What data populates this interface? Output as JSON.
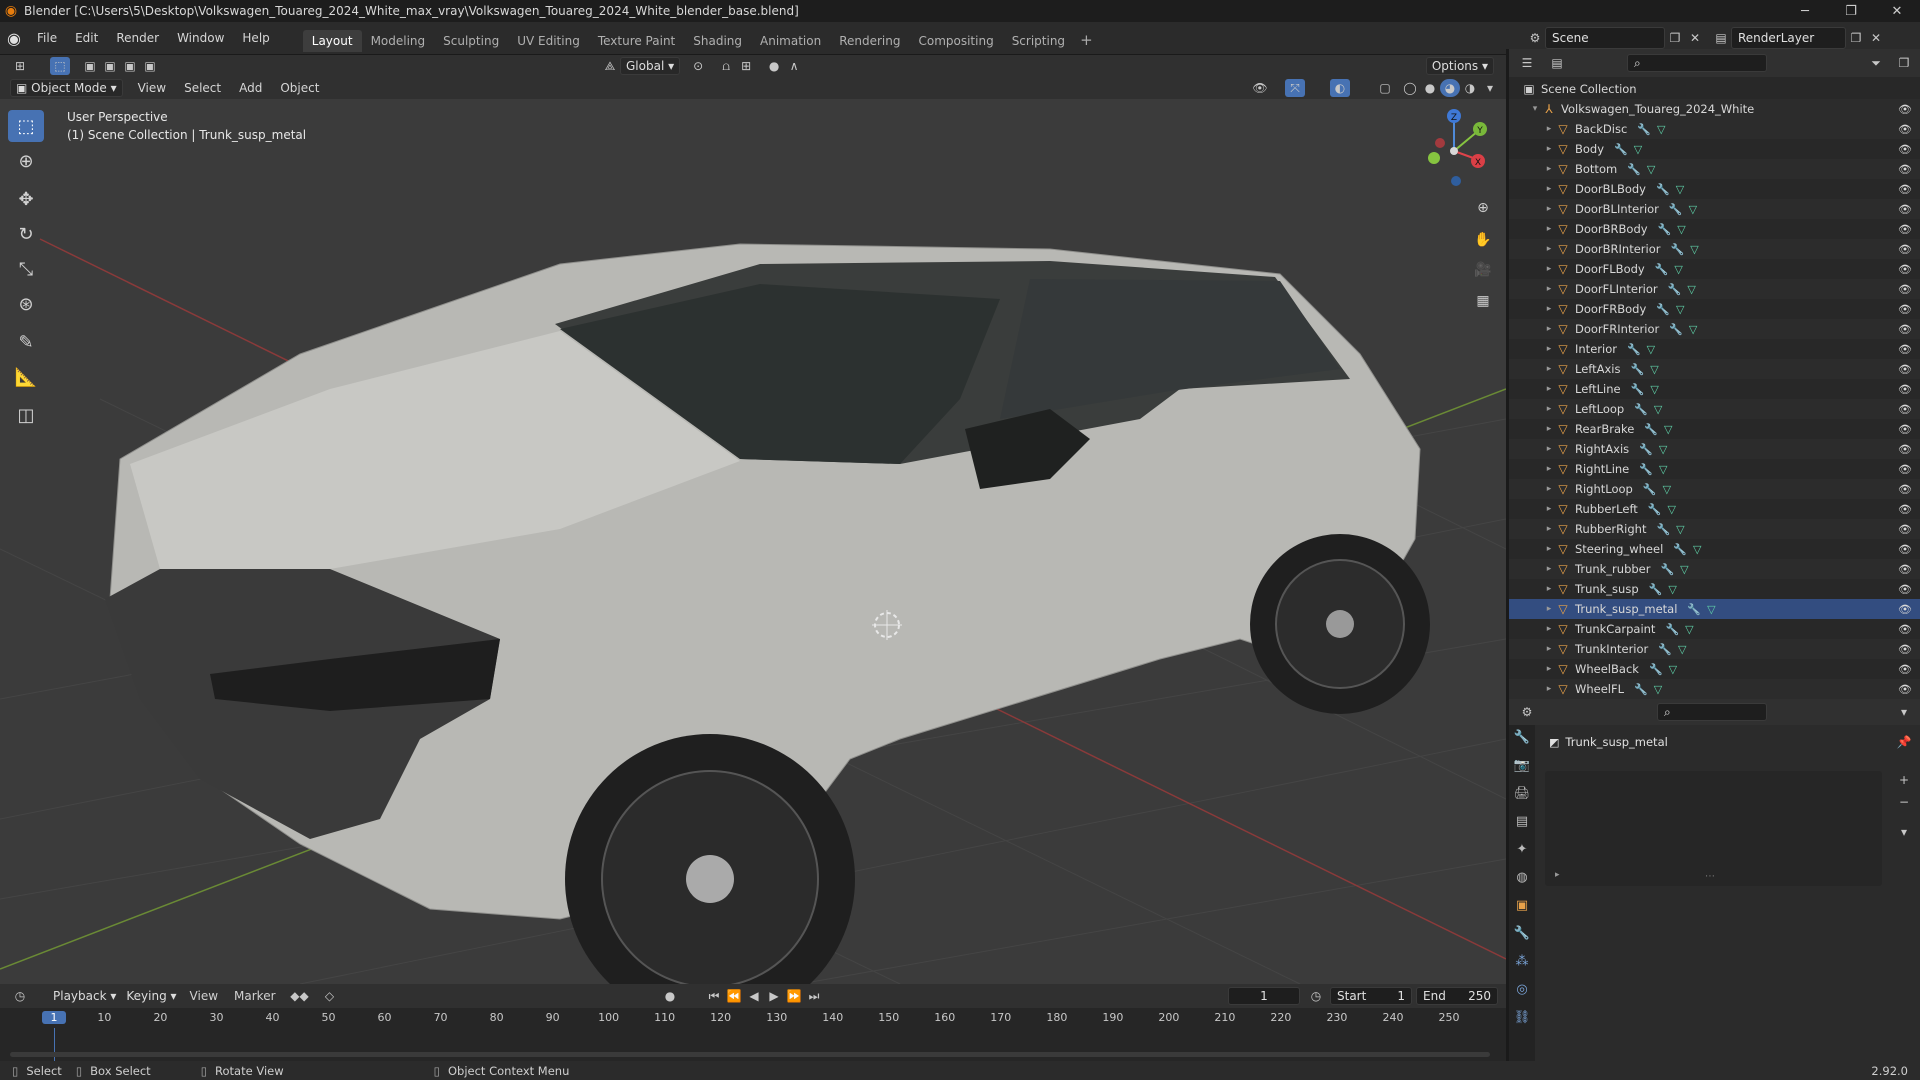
{
  "window": {
    "title": "Blender [C:\\Users\\5\\Desktop\\Volkswagen_Touareg_2024_White_max_vray\\Volkswagen_Touareg_2024_White_blender_base.blend]",
    "min": "─",
    "max": "❐",
    "close": "✕"
  },
  "menu": [
    "File",
    "Edit",
    "Render",
    "Window",
    "Help"
  ],
  "workspaces": [
    "Layout",
    "Modeling",
    "Sculpting",
    "UV Editing",
    "Texture Paint",
    "Shading",
    "Animation",
    "Rendering",
    "Compositing",
    "Scripting"
  ],
  "active_workspace": "Layout",
  "scene": {
    "name": "Scene",
    "view_layer": "RenderLayer"
  },
  "tool_header": {
    "orientation": "Global",
    "options": "Options"
  },
  "viewport_header": {
    "mode": "Object Mode",
    "menus": [
      "View",
      "Select",
      "Add",
      "Object"
    ]
  },
  "viewport": {
    "info_line1": "User Perspective",
    "info_line2": "(1) Scene Collection | Trunk_susp_metal",
    "gizmo": {
      "z": "Z",
      "y": "Y",
      "x": "X"
    }
  },
  "outliner": {
    "root": "Scene Collection",
    "collection": "Volkswagen_Touareg_2024_White",
    "items": [
      "BackDisc",
      "Body",
      "Bottom",
      "DoorBLBody",
      "DoorBLInterior",
      "DoorBRBody",
      "DoorBRInterior",
      "DoorFLBody",
      "DoorFLInterior",
      "DoorFRBody",
      "DoorFRInterior",
      "Interior",
      "LeftAxis",
      "LeftLine",
      "LeftLoop",
      "RearBrake",
      "RightAxis",
      "RightLine",
      "RightLoop",
      "RubberLeft",
      "RubberRight",
      "Steering_wheel",
      "Trunk_rubber",
      "Trunk_susp",
      "Trunk_susp_metal",
      "TrunkCarpaint",
      "TrunkInterior",
      "WheelBack",
      "WheelFL"
    ],
    "selected": "Trunk_susp_metal"
  },
  "properties": {
    "object_name": "Trunk_susp_metal"
  },
  "timeline": {
    "menus": [
      "Playback",
      "Keying",
      "View",
      "Marker"
    ],
    "current_frame": "1",
    "start_label": "Start",
    "start": "1",
    "end_label": "End",
    "end": "250",
    "ticks": [
      "1",
      "10",
      "20",
      "30",
      "40",
      "50",
      "60",
      "70",
      "80",
      "90",
      "100",
      "110",
      "120",
      "130",
      "140",
      "150",
      "160",
      "170",
      "180",
      "190",
      "200",
      "210",
      "220",
      "230",
      "240",
      "250"
    ]
  },
  "status": {
    "select": "Select",
    "box_select": "Box Select",
    "rotate": "Rotate View",
    "context": "Object Context Menu",
    "version": "2.92.0"
  }
}
